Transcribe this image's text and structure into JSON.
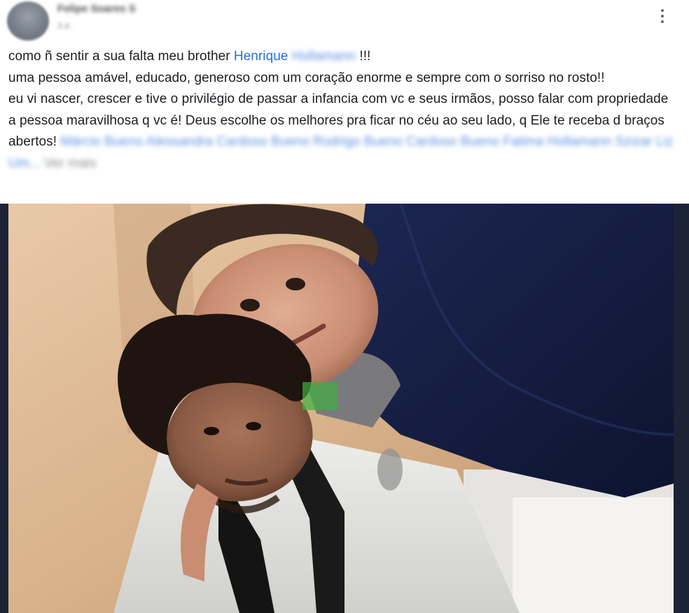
{
  "post": {
    "author_name": "Felipe Soares S",
    "meta": "3 d · ",
    "lines": [
      "como ñ sentir a sua falta meu brother",
      "uma pessoa amável, educado, generoso com um coração enorme e sempre com o sorriso no rosto!!",
      "eu vi nascer, crescer e tive o privilégio de passar a infancia com vc e seus irmãos, posso falar com propriedade a pessoa maravilhosa q vc é! Deus escolhe os melhores pra ficar no céu ao seu lado, q Ele te receba d braços abertos!"
    ],
    "mention_first": "Henrique",
    "mention_last": "Hollamann",
    "exclaim": " !!!",
    "tagged_people": "Márcio Bueno Alessandra Cardoso Bueno Rodrigo Bueno Cardoso Bueno Fatima Hollamann Szizar Liz Um...",
    "see_more": "Ver mais"
  },
  "colors": {
    "mention": "#216fdb",
    "text": "#1c1e21",
    "photo_border": "#1d2336"
  },
  "icons": {
    "more": "three-dots-vertical-icon"
  }
}
